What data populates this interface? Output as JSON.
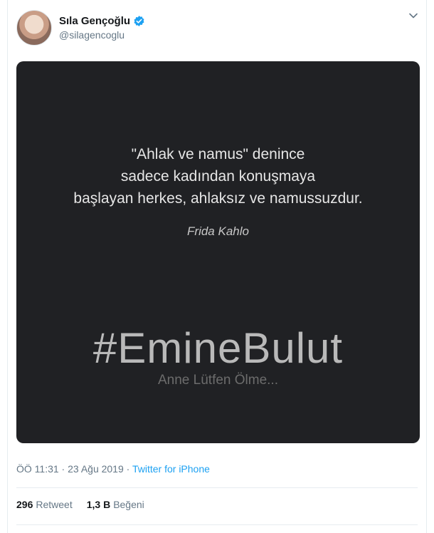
{
  "user": {
    "display_name": "Sıla Gençoğlu",
    "handle": "@silagencoglu",
    "verified_icon": "verified-badge-icon"
  },
  "media": {
    "quote_lines": [
      "\"Ahlak ve namus\" denince",
      "sadece kadından konuşmaya",
      "başlayan herkes, ahlaksız ve namussuzdur."
    ],
    "author": "Frida Kahlo",
    "hashtag": "#EmineBulut",
    "subtitle": "Anne Lütfen Ölme..."
  },
  "meta": {
    "time": "ÖÖ 11:31",
    "separator1": " · ",
    "date": "23 Ağu 2019",
    "separator2": " · ",
    "source": "Twitter for iPhone"
  },
  "stats": {
    "retweets_count": "296",
    "retweets_label": "Retweet",
    "likes_count": "1,3 B",
    "likes_label": "Beğeni"
  },
  "colors": {
    "accent": "#1da1f2",
    "media_bg": "#202124",
    "secondary_text": "#657786"
  }
}
